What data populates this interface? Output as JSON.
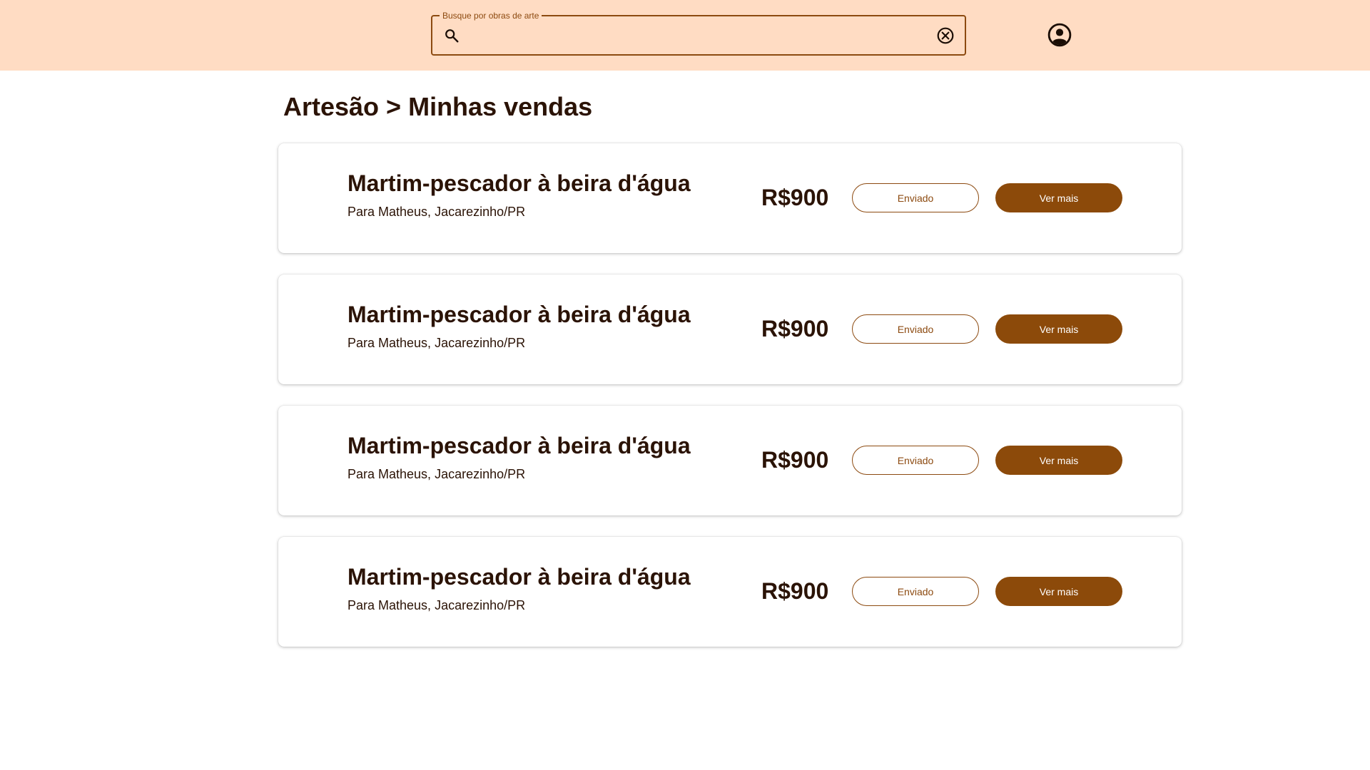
{
  "colors": {
    "header_bg": "#ffdcc3",
    "accent": "#8c4a0a",
    "text": "#2b1306",
    "background": "#ffffff"
  },
  "header": {
    "search": {
      "label": "Busque por obras de arte",
      "value": "",
      "placeholder": "",
      "icon": "search-icon",
      "clear_icon": "clear-circle-icon"
    },
    "account_icon": "account-circle-icon"
  },
  "page": {
    "title": "Artesão > Minhas vendas"
  },
  "sales": [
    {
      "title": "Martim-pescador à beira d'água",
      "recipient": "Para Matheus, Jacarezinho/PR",
      "price": "R$900",
      "status": "Enviado",
      "action": "Ver mais"
    },
    {
      "title": "Martim-pescador à beira d'água",
      "recipient": "Para Matheus, Jacarezinho/PR",
      "price": "R$900",
      "status": "Enviado",
      "action": "Ver mais"
    },
    {
      "title": "Martim-pescador à beira d'água",
      "recipient": "Para Matheus, Jacarezinho/PR",
      "price": "R$900",
      "status": "Enviado",
      "action": "Ver mais"
    },
    {
      "title": "Martim-pescador à beira d'água",
      "recipient": "Para Matheus, Jacarezinho/PR",
      "price": "R$900",
      "status": "Enviado",
      "action": "Ver mais"
    }
  ]
}
